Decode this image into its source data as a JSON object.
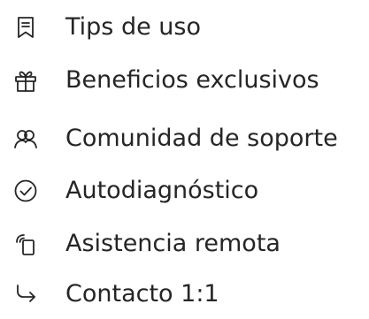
{
  "menu": {
    "items": [
      {
        "label": "Tips de uso",
        "icon": "bookmark-list-icon"
      },
      {
        "label": "Beneficios exclusivos",
        "icon": "gift-icon"
      },
      {
        "label": "Comunidad de soporte",
        "icon": "community-icon"
      },
      {
        "label": "Autodiagnóstico",
        "icon": "check-circle-icon"
      },
      {
        "label": "Asistencia remota",
        "icon": "remote-phone-icon"
      },
      {
        "label": "Contacto 1:1",
        "icon": "forward-arrow-icon"
      }
    ]
  },
  "colors": {
    "text": "#252525",
    "background": "#ffffff"
  }
}
